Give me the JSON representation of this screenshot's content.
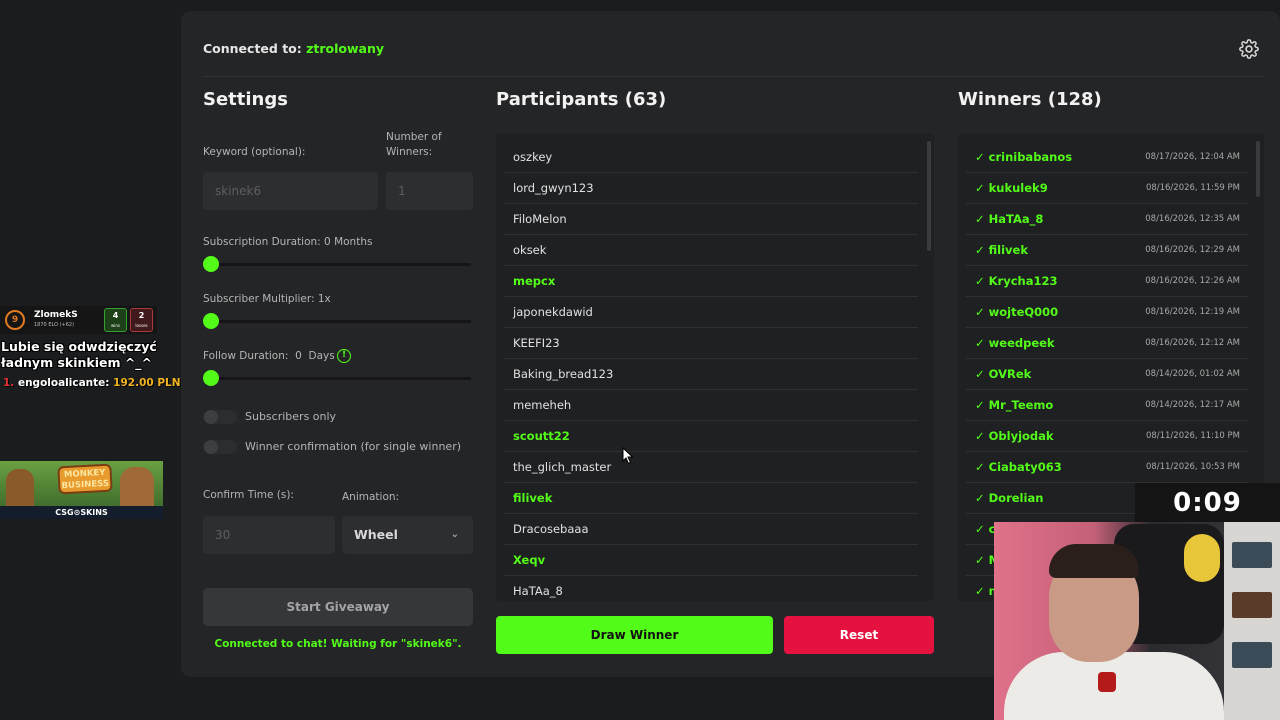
{
  "header": {
    "connected_prefix": "Connected to:",
    "channel": "ztrolowany"
  },
  "settings": {
    "title": "Settings",
    "keyword_label": "Keyword (optional):",
    "keyword_value": "skinek6",
    "winners_label_1": "Number of",
    "winners_label_2": "Winners:",
    "winners_value": "1",
    "sub_duration_label": "Subscription Duration: 0 Months",
    "sub_multiplier_label": "Subscriber Multiplier: 1x",
    "follow_label_prefix": "Follow Duration:",
    "follow_value": "0",
    "follow_unit": "Days",
    "info_glyph": "!",
    "subscribers_only_label": "Subscribers only",
    "winner_confirmation_label": "Winner confirmation (for single winner)",
    "confirm_time_label": "Confirm Time (s):",
    "confirm_time_value": "30",
    "animation_label": "Animation:",
    "animation_value": "Wheel",
    "start_button": "Start Giveaway",
    "status_text": "Connected to chat! Waiting for \"skinek6\"."
  },
  "participants": {
    "title": "Participants (63)",
    "items": [
      {
        "name": "oszkey",
        "highlight": false
      },
      {
        "name": "lord_gwyn123",
        "highlight": false
      },
      {
        "name": "FiloMelon",
        "highlight": false
      },
      {
        "name": "oksek",
        "highlight": false
      },
      {
        "name": "mepcx",
        "highlight": true
      },
      {
        "name": "japonekdawid",
        "highlight": false
      },
      {
        "name": "KEEFI23",
        "highlight": false
      },
      {
        "name": "Baking_bread123",
        "highlight": false
      },
      {
        "name": "memeheh",
        "highlight": false
      },
      {
        "name": "scoutt22",
        "highlight": true
      },
      {
        "name": "the_glich_master",
        "highlight": false
      },
      {
        "name": "filivek",
        "highlight": true
      },
      {
        "name": "Dracosebaaa",
        "highlight": false
      },
      {
        "name": "Xeqv",
        "highlight": true
      },
      {
        "name": "HaTAa_8",
        "highlight": false
      }
    ],
    "draw_button": "Draw Winner",
    "reset_button": "Reset"
  },
  "winners": {
    "title": "Winners (128)",
    "items": [
      {
        "name": "✓ crinibabanos",
        "date": "08/17/2026, 12:04 AM"
      },
      {
        "name": "✓ kukulek9",
        "date": "08/16/2026, 11:59 PM"
      },
      {
        "name": "✓ HaTAa_8",
        "date": "08/16/2026, 12:35 AM"
      },
      {
        "name": "✓ filivek",
        "date": "08/16/2026, 12:29 AM"
      },
      {
        "name": "✓ Krycha123",
        "date": "08/16/2026, 12:26 AM"
      },
      {
        "name": "✓ wojteQ000",
        "date": "08/16/2026, 12:19 AM"
      },
      {
        "name": "✓ weedpeek",
        "date": "08/16/2026, 12:12 AM"
      },
      {
        "name": "✓ OVRek",
        "date": "08/14/2026, 01:02 AM"
      },
      {
        "name": "✓ Mr_Teemo",
        "date": "08/14/2026, 12:17 AM"
      },
      {
        "name": "✓ Oblyjodak",
        "date": "08/11/2026, 11:10 PM"
      },
      {
        "name": "✓ Ciabaty063",
        "date": "08/11/2026, 10:53 PM"
      },
      {
        "name": "✓ Dorelian",
        "date": ""
      },
      {
        "name": "✓ c",
        "date": ""
      },
      {
        "name": "✓ M",
        "date": ""
      },
      {
        "name": "✓ n",
        "date": ""
      }
    ]
  },
  "overlay": {
    "faceit_level": "9",
    "faceit_name": "ZlomekS",
    "faceit_elo": "1870 ELO (+62)",
    "wins": "4",
    "wins_label": "wins",
    "losses": "2",
    "losses_label": "losses",
    "message_line1": "Lubie się odwdzięczyć",
    "message_line2": "ładnym skinkiem ^_^",
    "donor_rank": "1.",
    "donor_name": "engoloalicante:",
    "donor_amount": "192.00 PLN",
    "banner_title_1": "MONKEY",
    "banner_title_2": "BUSINESS",
    "banner_sponsor": "CSG⊙SKINS",
    "timer": "0:09"
  },
  "icons": {
    "settings": "gear-icon",
    "select": "chevron-down-icon",
    "info": "info-icon",
    "cursor": "mouse-cursor-icon"
  },
  "colors": {
    "accent": "#53fc18",
    "danger": "#e5123f",
    "panel": "#242527",
    "background": "#1b1c1e"
  }
}
